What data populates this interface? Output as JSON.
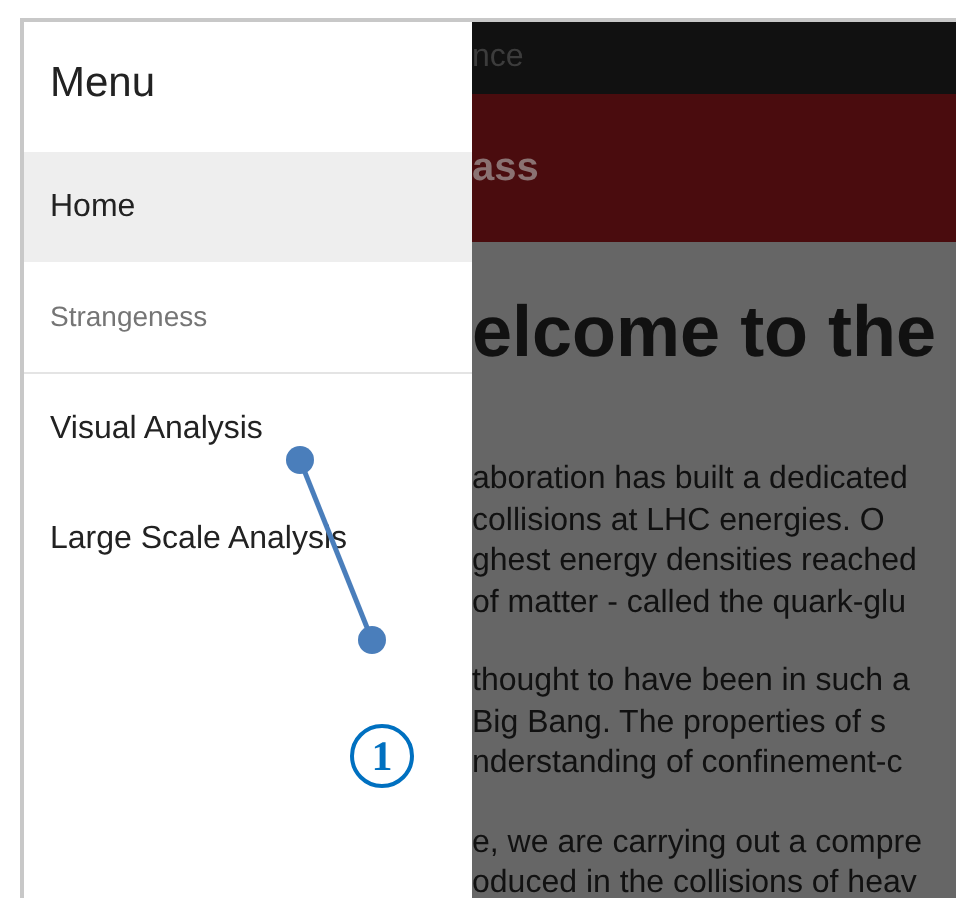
{
  "background_page": {
    "top_bar_text": "nce",
    "header_title": "ass",
    "heading": "elcome to the",
    "paragraphs": [
      [
        "aboration has built a dedicated",
        "collisions at LHC energies. O",
        "ghest energy densities reached",
        "of matter - called the quark-glu"
      ],
      [
        "thought to have been in such a",
        "Big Bang. The properties of s",
        "nderstanding of confinement-c"
      ],
      [
        "e, we are carrying out a compre",
        "oduced in the collisions of heav"
      ]
    ]
  },
  "menu": {
    "title": "Menu",
    "items": [
      {
        "kind": "link",
        "label": "Home",
        "selected": true
      },
      {
        "kind": "header",
        "label": "Strangeness"
      },
      {
        "kind": "link",
        "label": "Visual Analysis",
        "selected": false
      },
      {
        "kind": "link",
        "label": "Large Scale Analysis",
        "selected": false
      }
    ]
  },
  "annotation": {
    "label": "1"
  }
}
